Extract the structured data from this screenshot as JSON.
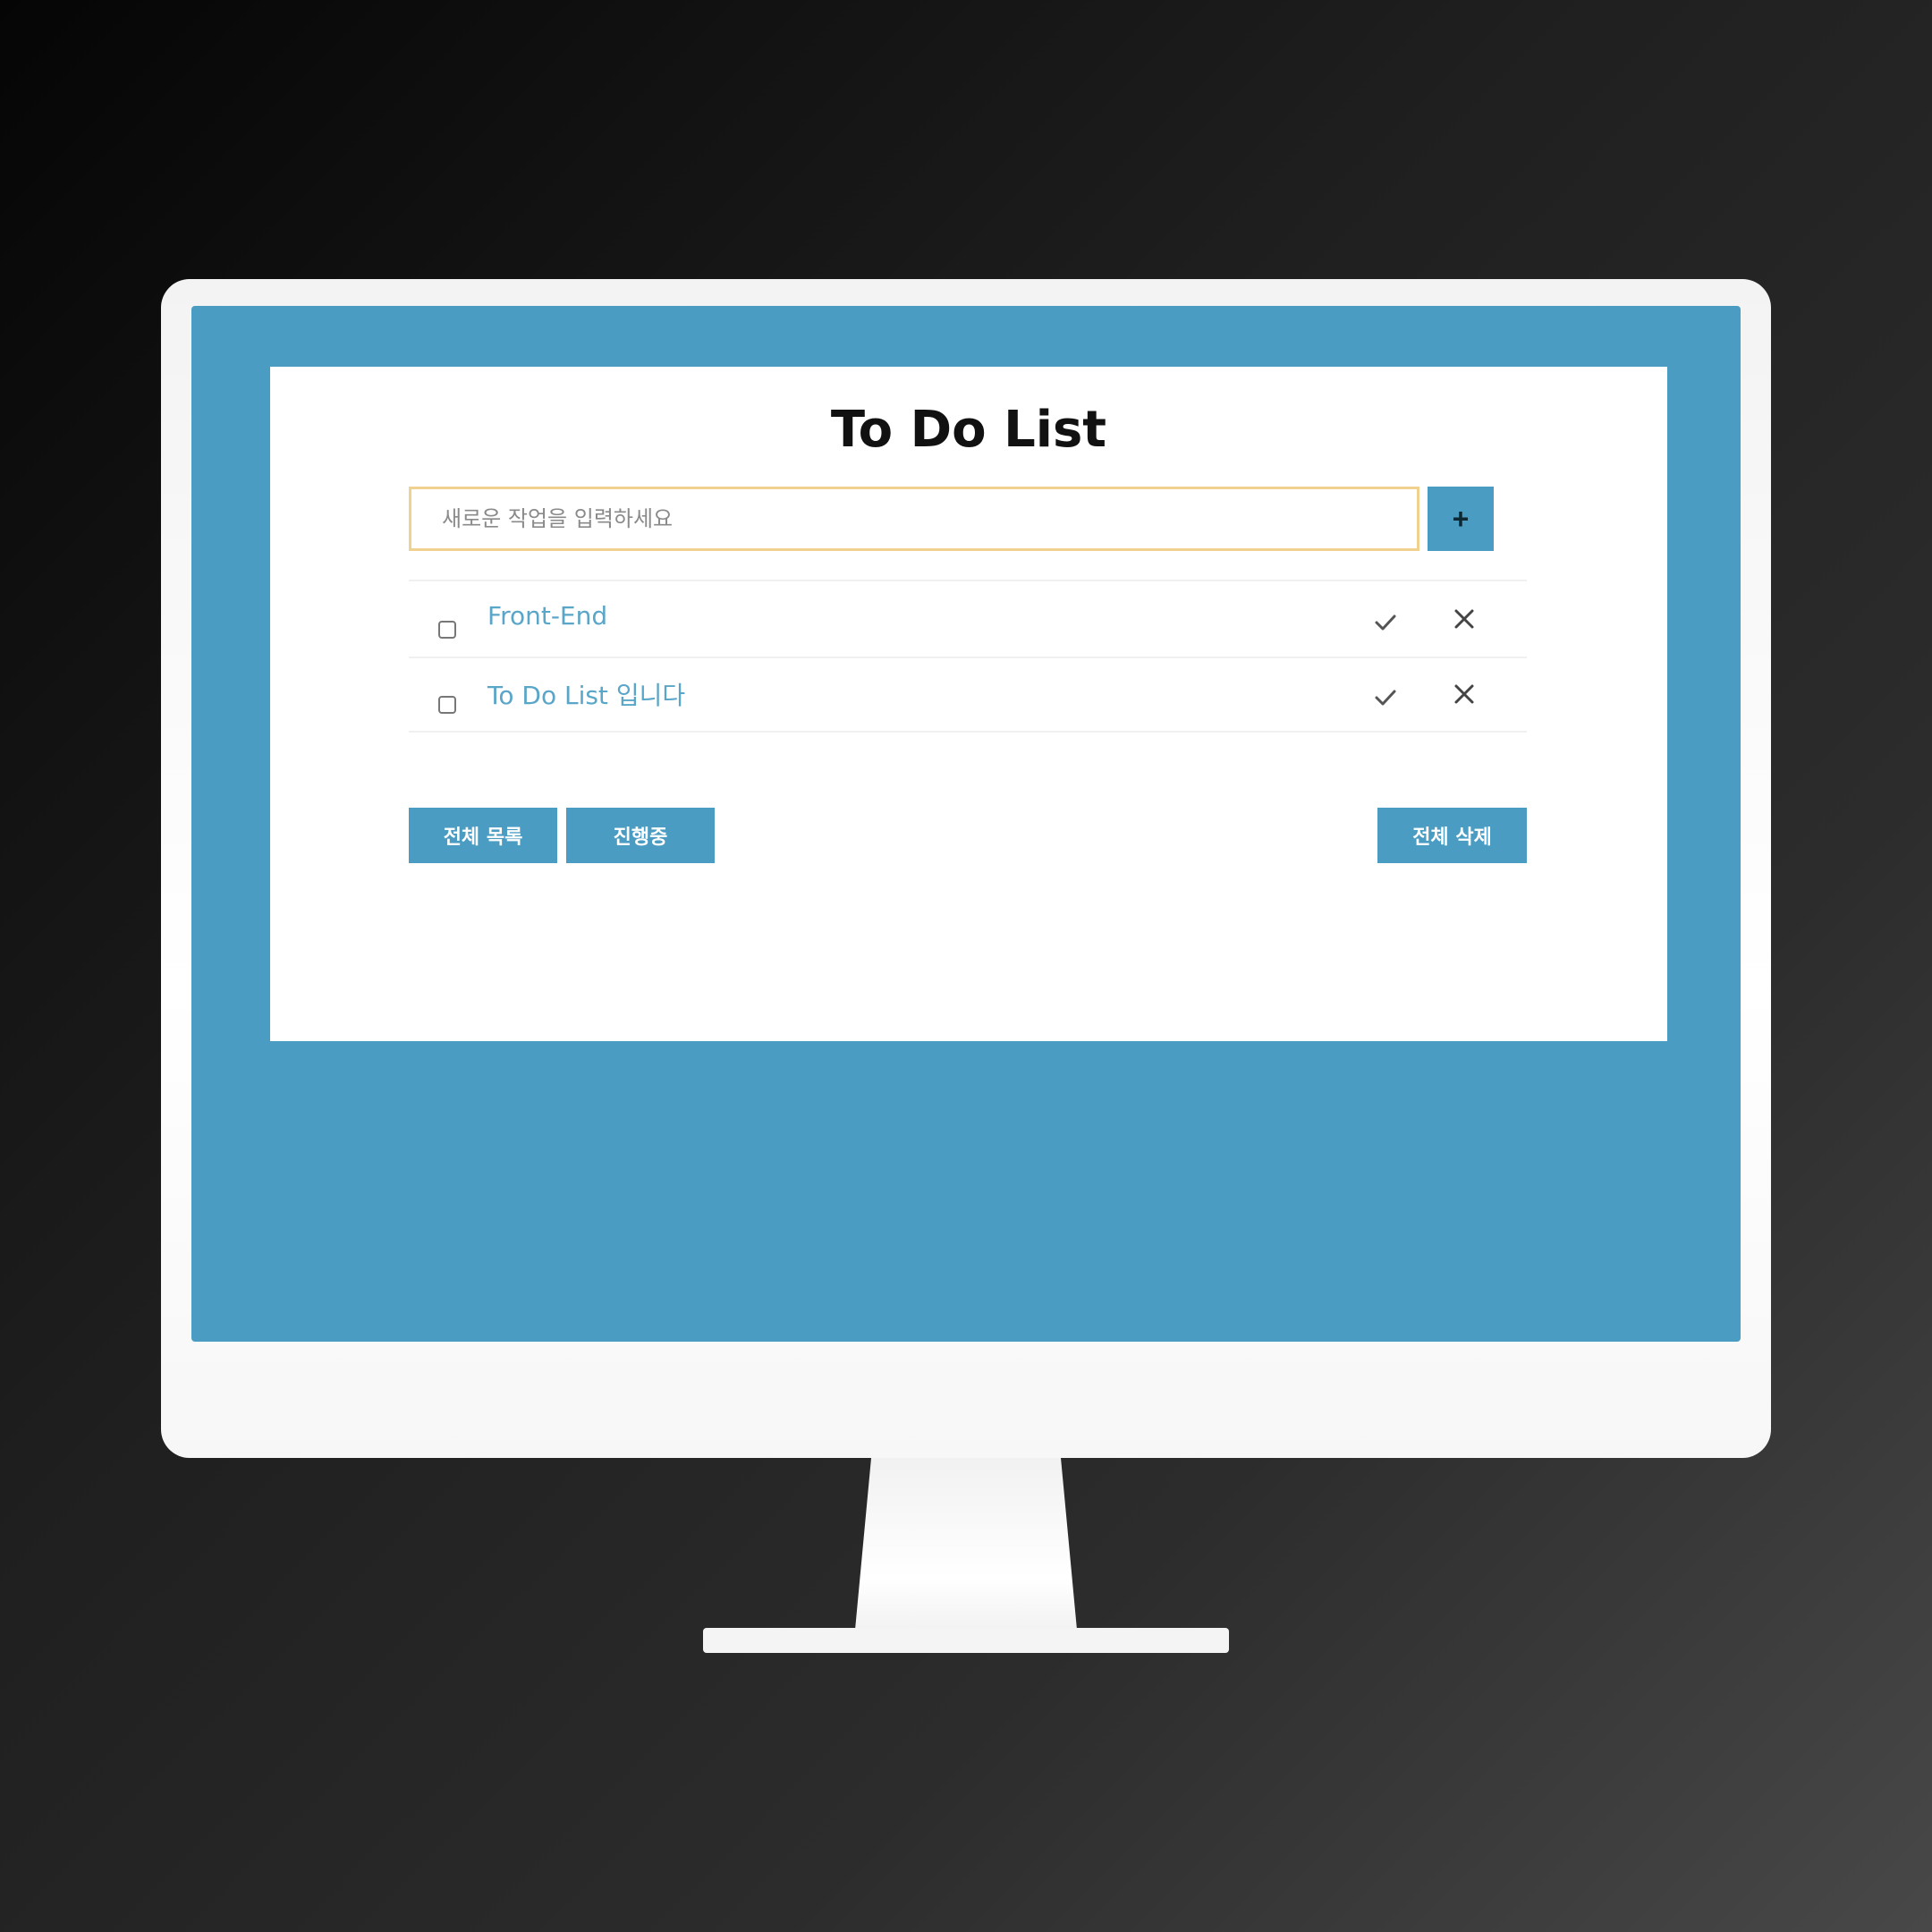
{
  "app": {
    "title": "To Do List"
  },
  "input": {
    "placeholder": "새로운 작업을 입력하세요",
    "value": ""
  },
  "add_button": {
    "label": "+"
  },
  "todos": [
    {
      "text": "Front-End",
      "checked": false
    },
    {
      "text": "To Do List 입니다",
      "checked": false
    }
  ],
  "buttons": {
    "all_list": "전체 목록",
    "in_progress": "진행중",
    "delete_all": "전체 삭제"
  },
  "colors": {
    "accent": "#4a9cc2",
    "input_border": "#f1d18f",
    "todo_text": "#5aa6c8",
    "background_dark": "#1f1f1f"
  },
  "icons": {
    "complete": "check-icon",
    "delete": "close-icon"
  }
}
